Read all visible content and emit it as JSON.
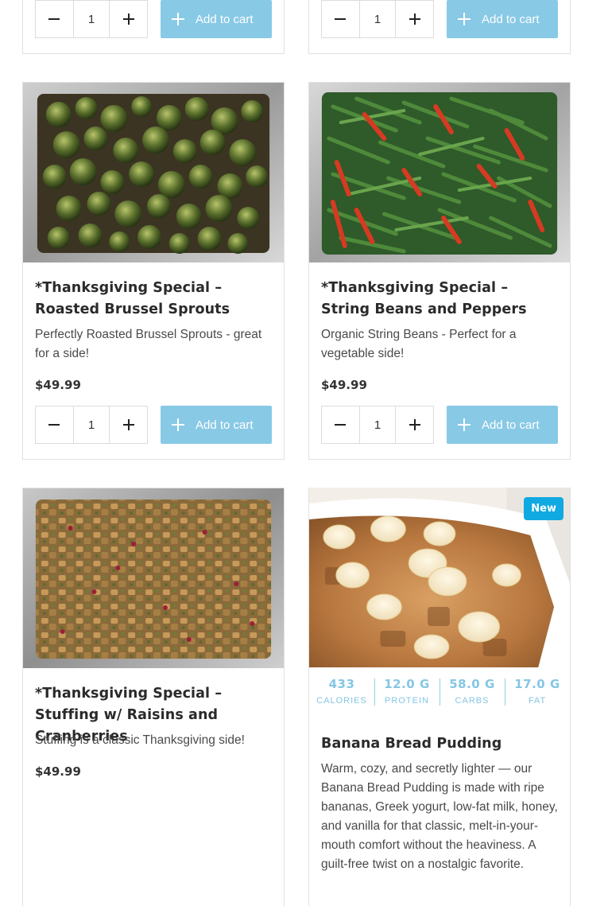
{
  "common": {
    "add_to_cart_label": "Add to cart",
    "accent_color": "#88c9e6",
    "badge_color": "#11a9e2"
  },
  "top_row": [
    {
      "qty": "1",
      "button": "Add to cart"
    },
    {
      "qty": "1",
      "button": "Add to cart"
    }
  ],
  "products": [
    {
      "title": "*Thanksgiving Special – Roasted Brussel Sprouts",
      "description": "Perfectly Roasted Brussel Sprouts - great for a side!",
      "price": "$49.99",
      "qty": "1",
      "image": "roasted-brussel-sprouts-photo"
    },
    {
      "title": "*Thanksgiving Special – String Beans and Peppers",
      "description": "Organic String Beans - Perfect for a vegetable side!",
      "price": "$49.99",
      "qty": "1",
      "image": "string-beans-peppers-photo"
    },
    {
      "title": "*Thanksgiving Special – Stuffing w/ Raisins and Cranberries",
      "description": "Stuffing is a classic Thanksgiving side!",
      "price": "$49.99",
      "image": "stuffing-photo"
    },
    {
      "title": "Banana Bread Pudding",
      "description": "Warm, cozy, and secretly lighter — our Banana Bread Pudding is made with ripe bananas, Greek yogurt, low-fat milk, honey, and vanilla for that classic, melt-in-your-mouth comfort without the heaviness. A guilt-free twist on a nostalgic favorite.",
      "badge": "New",
      "image": "banana-bread-pudding-photo",
      "nutrition": [
        {
          "value": "433",
          "label": "CALORIES"
        },
        {
          "value": "12.0 G",
          "label": "PROTEIN"
        },
        {
          "value": "58.0 G",
          "label": "CARBS"
        },
        {
          "value": "17.0 G",
          "label": "FAT"
        }
      ]
    }
  ]
}
